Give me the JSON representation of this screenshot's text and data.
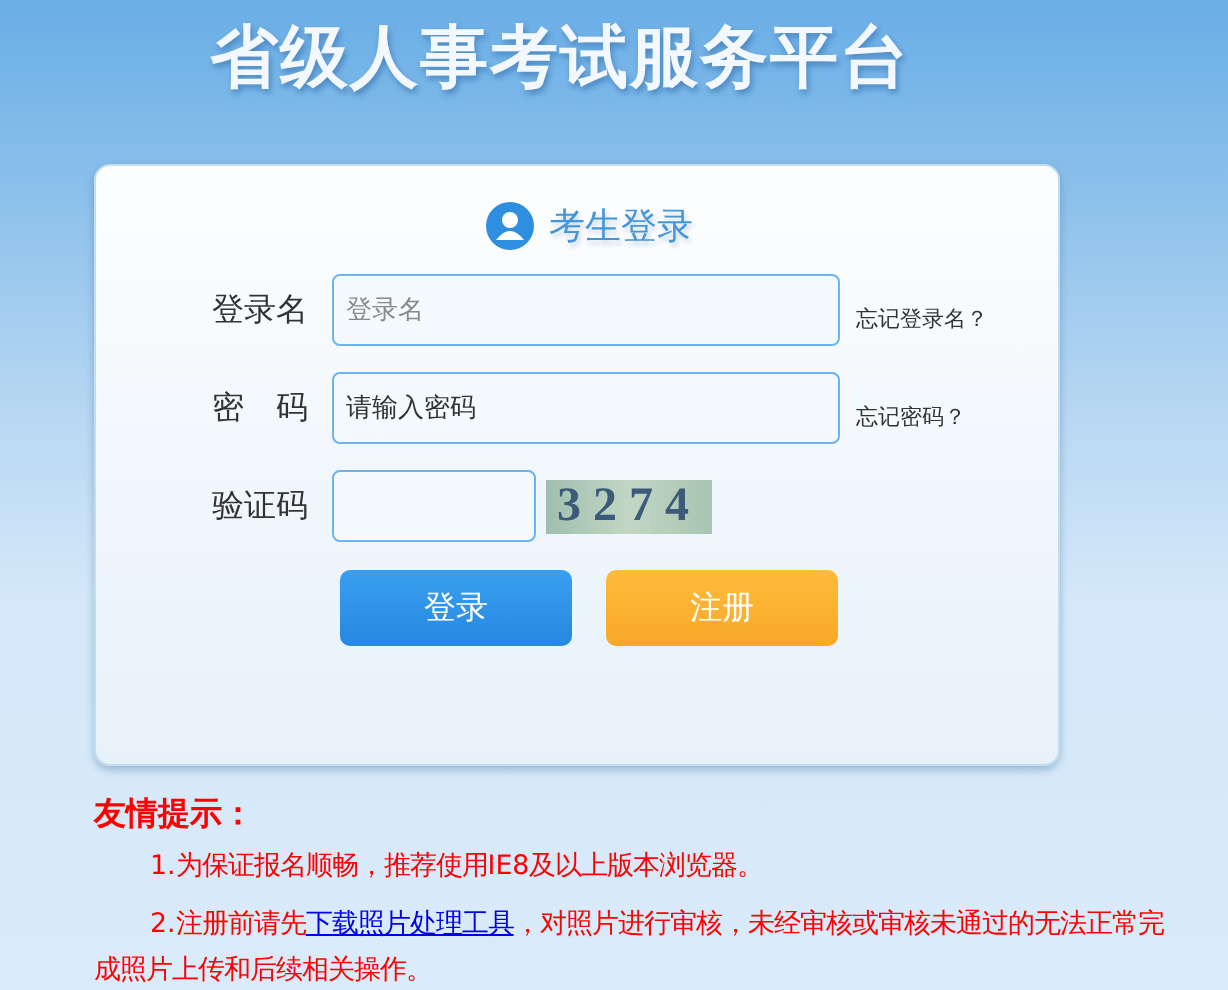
{
  "site_title": "省级人事考试服务平台",
  "login": {
    "heading": "考生登录",
    "fields": [
      {
        "label": "登录名",
        "placeholder": "登录名",
        "kind": "text",
        "link": "忘记登录名？"
      },
      {
        "label": "密　码",
        "placeholder": "请输入密码",
        "kind": "password",
        "link": "忘记密码？"
      },
      {
        "label": "验证码",
        "kind": "captcha",
        "captcha": "3274"
      }
    ],
    "buttons": [
      {
        "label": "登录",
        "kind": "primary"
      },
      {
        "label": "注册",
        "kind": "secondary"
      }
    ]
  },
  "tips": {
    "title": "友情提示：",
    "items": [
      {
        "text": "1.为保证报名顺畅，推荐使用IE8及以上版本浏览器。"
      },
      {
        "before": "2.注册前请先",
        "link": "下载照片处理工具",
        "after": "，对照片进行审核，未经审核或审核未通过的无法正常完成照片上传和后续相关操作。"
      }
    ]
  }
}
